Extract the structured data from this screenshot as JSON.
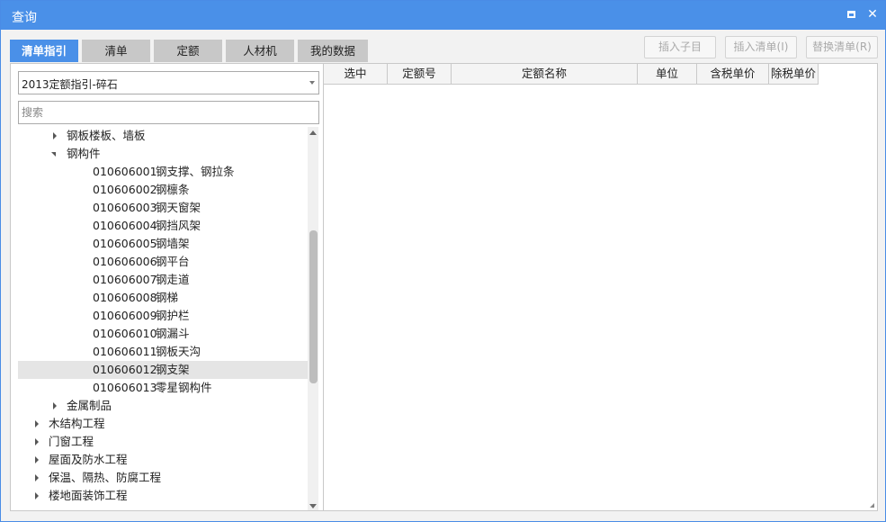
{
  "window": {
    "title": "查询"
  },
  "tabs": [
    {
      "label": "清单指引",
      "active": true
    },
    {
      "label": "清单",
      "active": false
    },
    {
      "label": "定额",
      "active": false
    },
    {
      "label": "人材机",
      "active": false
    },
    {
      "label": "我的数据",
      "active": false
    }
  ],
  "actions": {
    "insert_child": "插入子目",
    "insert_list": "插入清单(I)",
    "replace_list": "替换清单(R)"
  },
  "left": {
    "combo_value": "2013定额指引-碎石",
    "search_placeholder": "搜索"
  },
  "tree": [
    {
      "level": 2,
      "state": "collapsed",
      "code": "",
      "name": "钢板楼板、墙板"
    },
    {
      "level": 2,
      "state": "expanded",
      "code": "",
      "name": "钢构件"
    },
    {
      "level": 3,
      "state": "leaf",
      "code": "010606001",
      "name": "钢支撑、钢拉条"
    },
    {
      "level": 3,
      "state": "leaf",
      "code": "010606002",
      "name": "钢檩条"
    },
    {
      "level": 3,
      "state": "leaf",
      "code": "010606003",
      "name": "钢天窗架"
    },
    {
      "level": 3,
      "state": "leaf",
      "code": "010606004",
      "name": "钢挡风架"
    },
    {
      "level": 3,
      "state": "leaf",
      "code": "010606005",
      "name": "钢墙架"
    },
    {
      "level": 3,
      "state": "leaf",
      "code": "010606006",
      "name": "钢平台"
    },
    {
      "level": 3,
      "state": "leaf",
      "code": "010606007",
      "name": "钢走道"
    },
    {
      "level": 3,
      "state": "leaf",
      "code": "010606008",
      "name": "钢梯"
    },
    {
      "level": 3,
      "state": "leaf",
      "code": "010606009",
      "name": "钢护栏"
    },
    {
      "level": 3,
      "state": "leaf",
      "code": "010606010",
      "name": "钢漏斗"
    },
    {
      "level": 3,
      "state": "leaf",
      "code": "010606011",
      "name": "钢板天沟"
    },
    {
      "level": 3,
      "state": "leaf",
      "code": "010606012",
      "name": "钢支架",
      "selected": true
    },
    {
      "level": 3,
      "state": "leaf",
      "code": "010606013",
      "name": "零星钢构件"
    },
    {
      "level": 2,
      "state": "collapsed",
      "code": "",
      "name": "金属制品"
    },
    {
      "level": 1,
      "state": "collapsed",
      "code": "",
      "name": "木结构工程"
    },
    {
      "level": 1,
      "state": "collapsed",
      "code": "",
      "name": "门窗工程"
    },
    {
      "level": 1,
      "state": "collapsed",
      "code": "",
      "name": "屋面及防水工程"
    },
    {
      "level": 1,
      "state": "collapsed",
      "code": "",
      "name": "保温、隔热、防腐工程"
    },
    {
      "level": 1,
      "state": "collapsed",
      "code": "",
      "name": "楼地面装饰工程"
    }
  ],
  "table": {
    "columns": [
      "选中",
      "定额号",
      "定额名称",
      "单位",
      "含税单价",
      "除税单价"
    ]
  }
}
